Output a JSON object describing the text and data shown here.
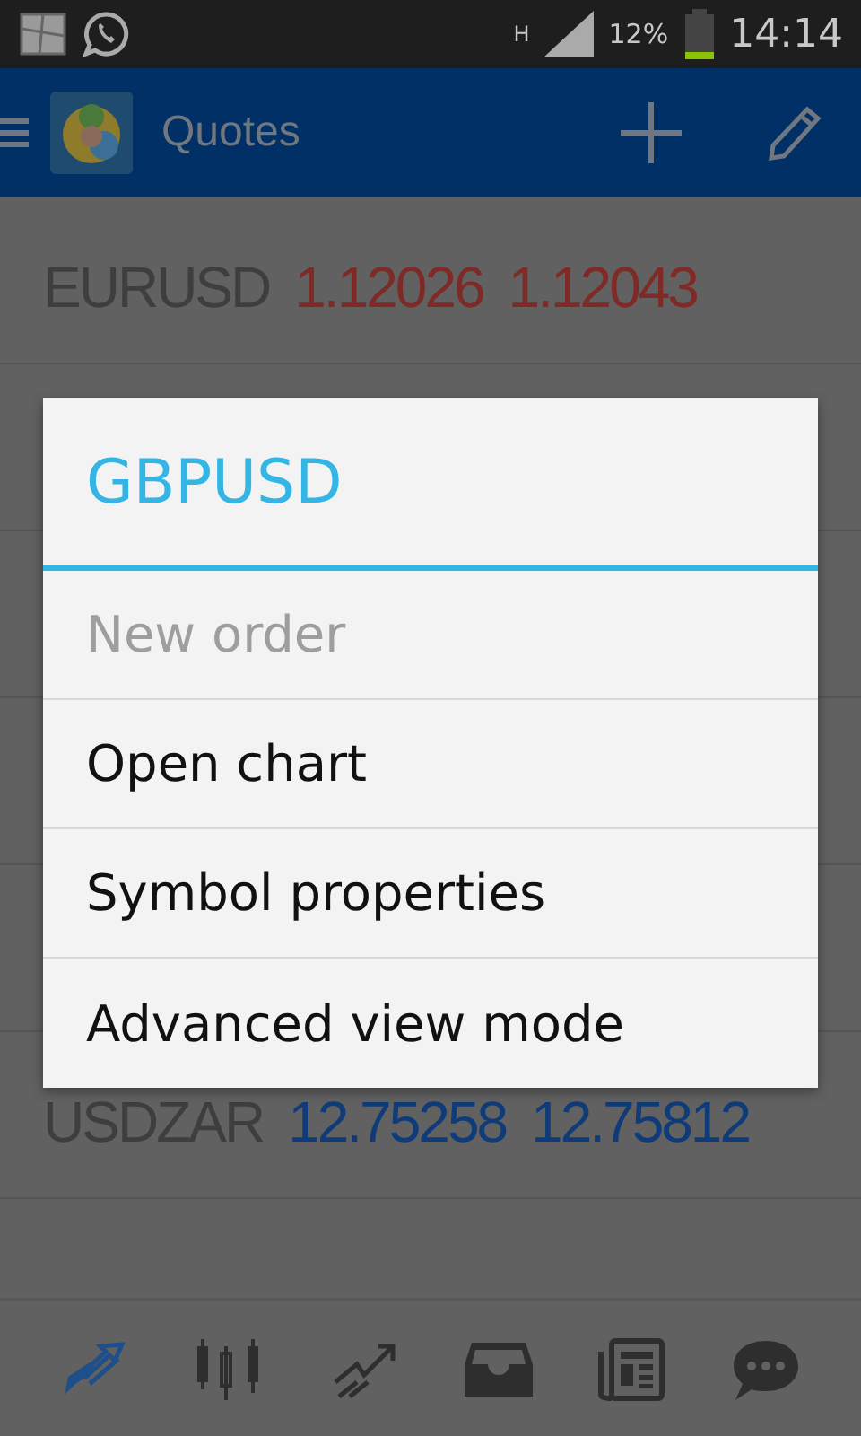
{
  "status_bar": {
    "network_type": "H",
    "battery": "12%",
    "time": "14:14"
  },
  "app_bar": {
    "title": "Quotes"
  },
  "quotes": [
    {
      "symbol": "EURUSD",
      "bid": "1.12026",
      "ask": "1.12043",
      "color": "#7e2a27"
    },
    {
      "symbol": "USDZAR",
      "bid": "12.75258",
      "ask": "12.75812",
      "color": "#0f3b78"
    }
  ],
  "dialog": {
    "title": "GBPUSD",
    "items": [
      {
        "label": "New order",
        "disabled": true
      },
      {
        "label": "Open chart",
        "disabled": false
      },
      {
        "label": "Symbol properties",
        "disabled": false
      },
      {
        "label": "Advanced view mode",
        "disabled": false
      }
    ]
  },
  "bottom_nav": [
    {
      "kind": "quotes",
      "selected": true
    },
    {
      "kind": "chart",
      "selected": false
    },
    {
      "kind": "trade",
      "selected": false
    },
    {
      "kind": "history",
      "selected": false
    },
    {
      "kind": "news",
      "selected": false
    },
    {
      "kind": "chat",
      "selected": false
    }
  ]
}
